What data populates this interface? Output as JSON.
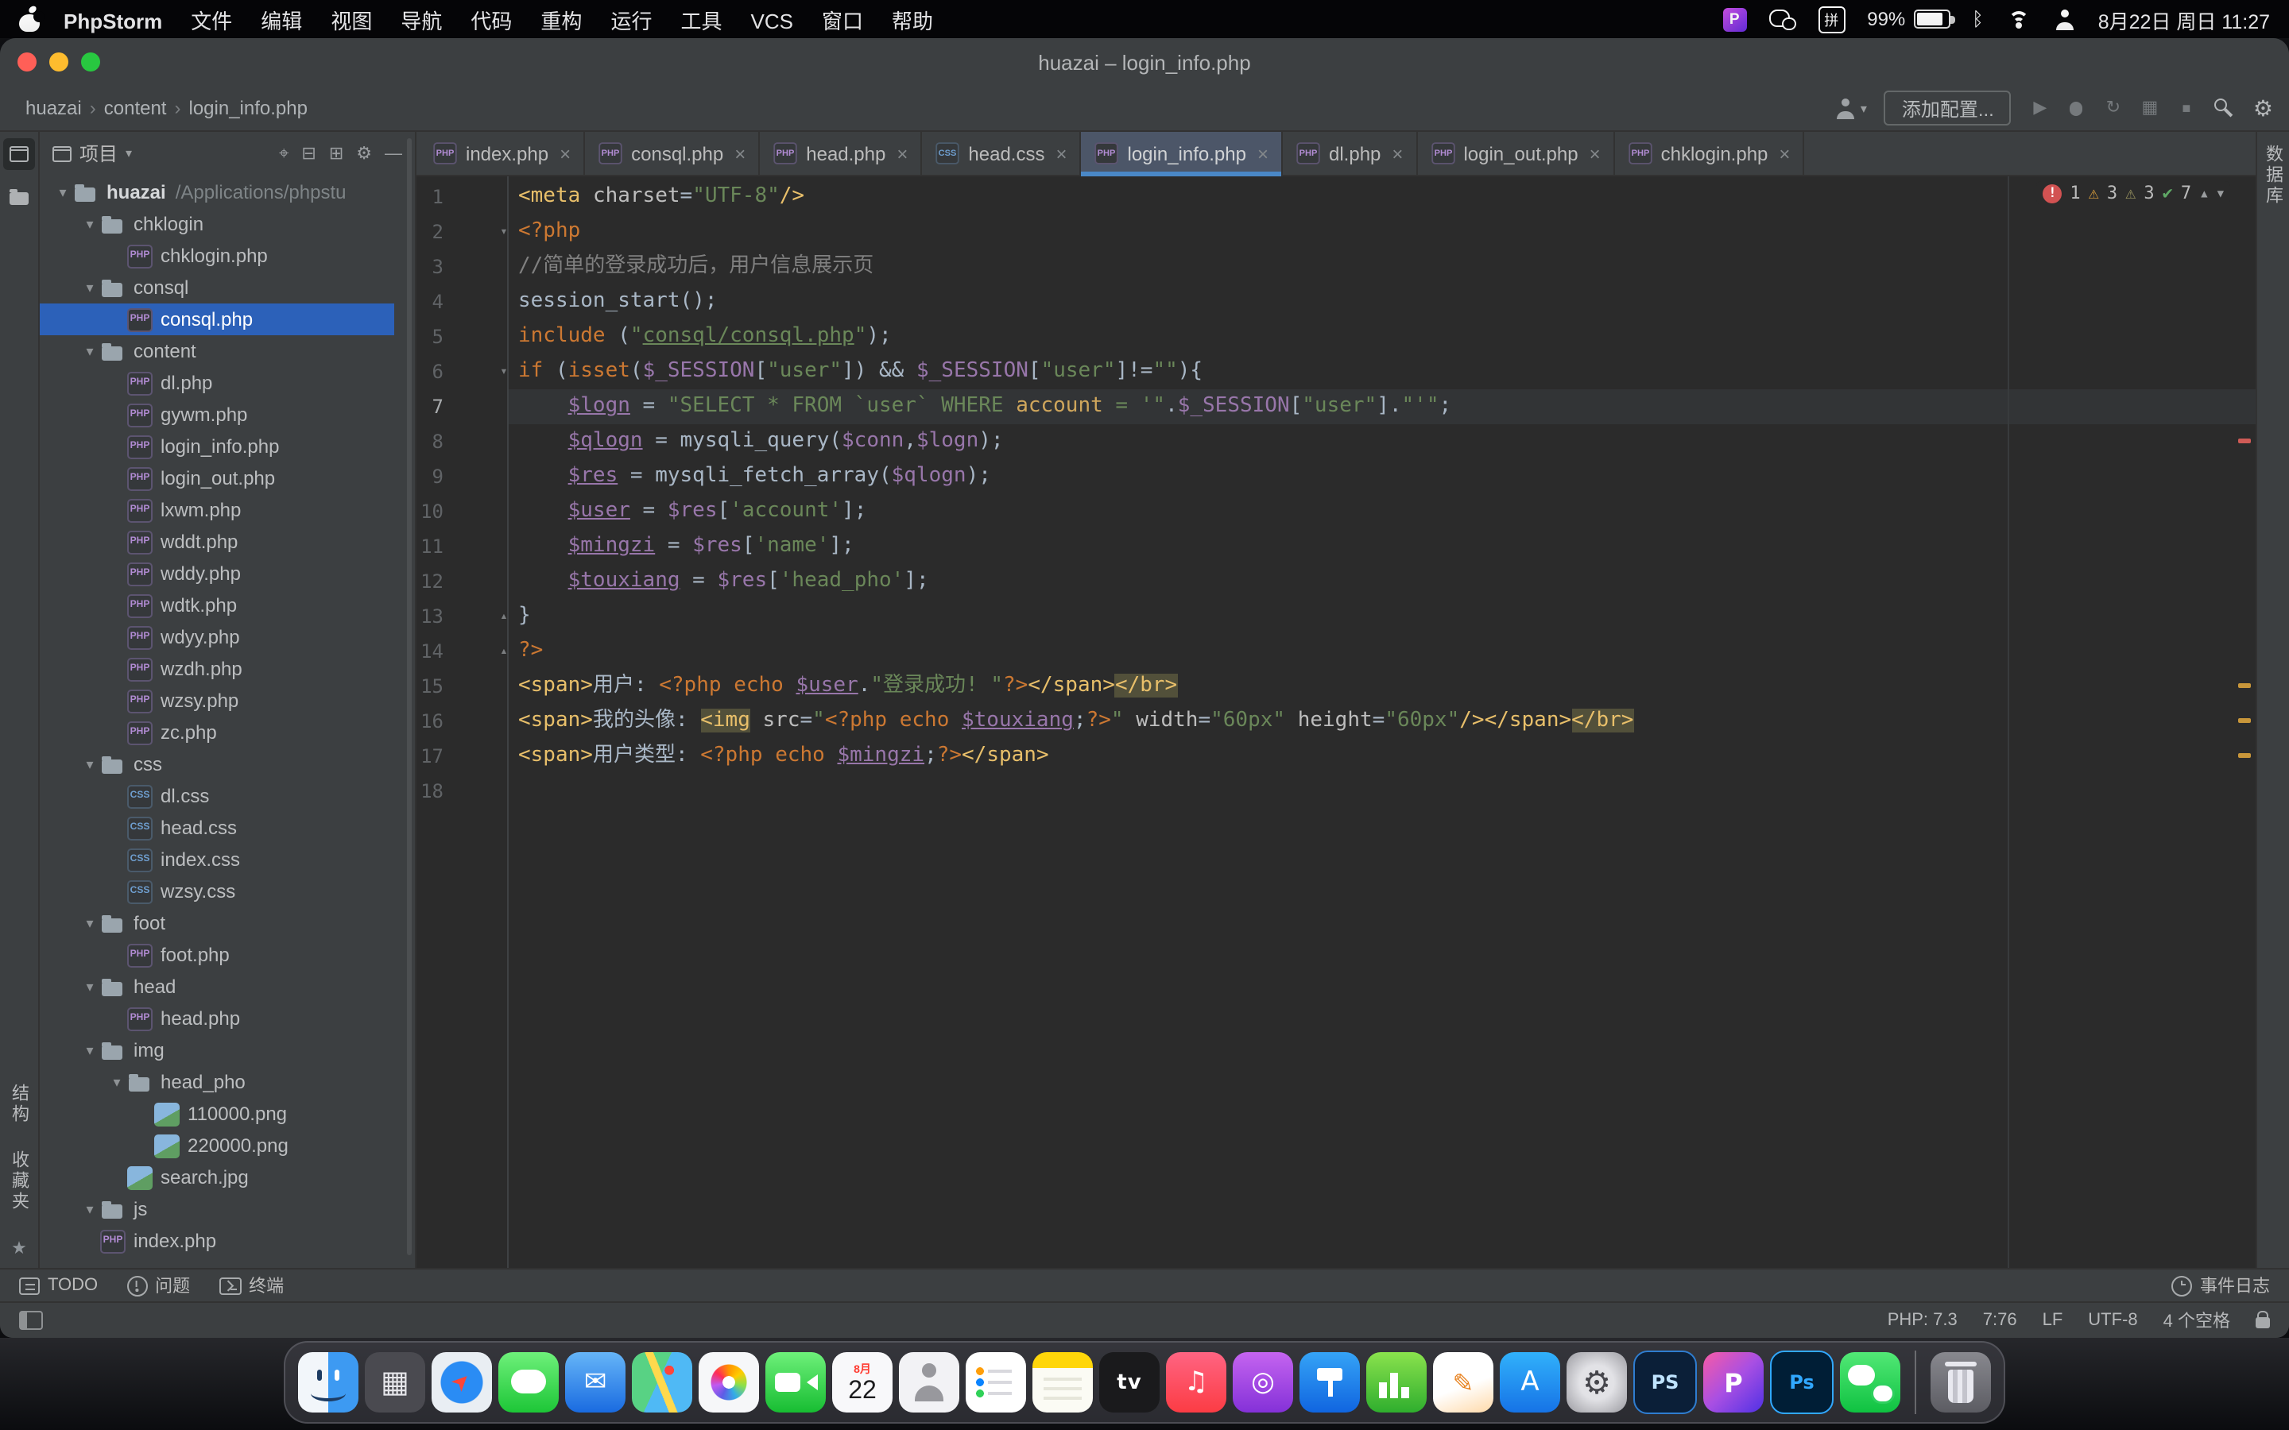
{
  "menubar": {
    "items": [
      "PhpStorm",
      "文件",
      "编辑",
      "视图",
      "导航",
      "代码",
      "重构",
      "运行",
      "工具",
      "VCS",
      "窗口",
      "帮助"
    ],
    "right": {
      "phpstorm_badge": "P",
      "ime": "拼",
      "battery_percent": "99%",
      "clock": "8月22日 周日 11:27"
    }
  },
  "window": {
    "title": "huazai – login_info.php"
  },
  "navbar": {
    "breadcrumbs": [
      "huazai",
      "content",
      "login_info.php"
    ],
    "run_config_label": "添加配置...",
    "toolbar": [
      {
        "name": "run-button",
        "glyph": "▶"
      },
      {
        "name": "debug-button",
        "glyph": ""
      },
      {
        "name": "coverage-button",
        "glyph": "↻"
      },
      {
        "name": "profiler-button",
        "glyph": "▦"
      },
      {
        "name": "stop-button",
        "glyph": "■"
      }
    ]
  },
  "tool_strips": {
    "structure": "结构",
    "favorites": "收藏夹",
    "database": "数据库"
  },
  "project_panel": {
    "title": "项目",
    "header_icons": [
      {
        "name": "locate",
        "glyph": "⌖"
      },
      {
        "name": "collapse-all",
        "glyph": "⊟"
      },
      {
        "name": "expand-all",
        "glyph": "⊞"
      },
      {
        "name": "panel-settings",
        "glyph": "⚙"
      },
      {
        "name": "hide-panel",
        "glyph": "—"
      }
    ],
    "tree": [
      {
        "n": "huazai",
        "t": "root",
        "d": 0,
        "c": true,
        "path": "/Applications/phpstu"
      },
      {
        "n": "chklogin",
        "t": "folder",
        "d": 1,
        "c": true
      },
      {
        "n": "chklogin.php",
        "t": "php",
        "d": 2
      },
      {
        "n": "consql",
        "t": "folder",
        "d": 1,
        "c": true
      },
      {
        "n": "consql.php",
        "t": "php",
        "d": 2,
        "sel": true
      },
      {
        "n": "content",
        "t": "folder",
        "d": 1,
        "c": true
      },
      {
        "n": "dl.php",
        "t": "php",
        "d": 2
      },
      {
        "n": "gywm.php",
        "t": "php",
        "d": 2
      },
      {
        "n": "login_info.php",
        "t": "php",
        "d": 2
      },
      {
        "n": "login_out.php",
        "t": "php",
        "d": 2
      },
      {
        "n": "lxwm.php",
        "t": "php",
        "d": 2
      },
      {
        "n": "wddt.php",
        "t": "php",
        "d": 2
      },
      {
        "n": "wddy.php",
        "t": "php",
        "d": 2
      },
      {
        "n": "wdtk.php",
        "t": "php",
        "d": 2
      },
      {
        "n": "wdyy.php",
        "t": "php",
        "d": 2
      },
      {
        "n": "wzdh.php",
        "t": "php",
        "d": 2
      },
      {
        "n": "wzsy.php",
        "t": "php",
        "d": 2
      },
      {
        "n": "zc.php",
        "t": "php",
        "d": 2
      },
      {
        "n": "css",
        "t": "folder",
        "d": 1,
        "c": true
      },
      {
        "n": "dl.css",
        "t": "css",
        "d": 2
      },
      {
        "n": "head.css",
        "t": "css",
        "d": 2
      },
      {
        "n": "index.css",
        "t": "css",
        "d": 2
      },
      {
        "n": "wzsy.css",
        "t": "css",
        "d": 2
      },
      {
        "n": "foot",
        "t": "folder",
        "d": 1,
        "c": true
      },
      {
        "n": "foot.php",
        "t": "php",
        "d": 2
      },
      {
        "n": "head",
        "t": "folder",
        "d": 1,
        "c": true
      },
      {
        "n": "head.php",
        "t": "php",
        "d": 2
      },
      {
        "n": "img",
        "t": "folder",
        "d": 1,
        "c": true
      },
      {
        "n": "head_pho",
        "t": "folder",
        "d": 2,
        "c": true
      },
      {
        "n": "110000.png",
        "t": "img",
        "d": 3
      },
      {
        "n": "220000.png",
        "t": "img",
        "d": 3
      },
      {
        "n": "search.jpg",
        "t": "img",
        "d": 2
      },
      {
        "n": "js",
        "t": "folder",
        "d": 1,
        "c": true
      },
      {
        "n": "index.php",
        "t": "php",
        "d": 1
      }
    ]
  },
  "editor_tabs": [
    {
      "name": "index.php",
      "type": "php"
    },
    {
      "name": "consql.php",
      "type": "php"
    },
    {
      "name": "head.php",
      "type": "php"
    },
    {
      "name": "head.css",
      "type": "css"
    },
    {
      "name": "login_info.php",
      "type": "php",
      "active": true
    },
    {
      "name": "dl.php",
      "type": "php"
    },
    {
      "name": "login_out.php",
      "type": "php"
    },
    {
      "name": "chklogin.php",
      "type": "php"
    }
  ],
  "editor": {
    "current_line": 7,
    "fold_down": [
      2,
      6
    ],
    "fold_up": [
      13,
      14
    ],
    "inspections": {
      "errors": "1",
      "warnings": "3",
      "weak_warnings": "3",
      "ok": "7"
    },
    "stripe_marks": [
      {
        "line": 8,
        "type": "error"
      },
      {
        "line": 15,
        "type": "warning"
      },
      {
        "line": 16,
        "type": "warning"
      },
      {
        "line": 17,
        "type": "warning"
      }
    ],
    "lines": [
      [
        [
          "<meta ",
          "t"
        ],
        [
          "charset",
          "a"
        ],
        [
          "=",
          "p"
        ],
        [
          "\"UTF-8\"",
          "s"
        ],
        [
          "/>",
          "t"
        ]
      ],
      [
        [
          "<?php",
          "k"
        ]
      ],
      [
        [
          "//简单的登录成功后，用户信息展示页",
          "c"
        ]
      ],
      [
        [
          "session_start();",
          "p"
        ]
      ],
      [
        [
          "include ",
          "k"
        ],
        [
          "(",
          "p"
        ],
        [
          "\"",
          "s"
        ],
        [
          "consql/consql.php",
          "su"
        ],
        [
          "\"",
          "s"
        ],
        [
          ");",
          "p"
        ]
      ],
      [
        [
          "if ",
          "k"
        ],
        [
          "(",
          "p"
        ],
        [
          "isset",
          "k"
        ],
        [
          "(",
          "p"
        ],
        [
          "$_SESSION",
          "v"
        ],
        [
          "[",
          "p"
        ],
        [
          "\"user\"",
          "s"
        ],
        [
          "]",
          "p"
        ],
        [
          ") && ",
          "p"
        ],
        [
          "$_SESSION",
          "v"
        ],
        [
          "[",
          "p"
        ],
        [
          "\"user\"",
          "s"
        ],
        [
          "]",
          "p"
        ],
        [
          "!=",
          "p"
        ],
        [
          "\"\"",
          "s"
        ],
        [
          "){",
          "p"
        ]
      ],
      [
        [
          "    ",
          "p"
        ],
        [
          "$logn",
          "vu"
        ],
        [
          " = ",
          "p"
        ],
        [
          "\"SELECT * FROM `user` WHERE ",
          "s"
        ],
        [
          "account",
          "q"
        ],
        [
          " = '\"",
          "s"
        ],
        [
          ".",
          "p"
        ],
        [
          "$_SESSION",
          "v"
        ],
        [
          "[",
          "p"
        ],
        [
          "\"user\"",
          "s"
        ],
        [
          "]",
          "p"
        ],
        [
          ".",
          "p"
        ],
        [
          "\"'\"",
          "s"
        ],
        [
          ";",
          "p"
        ]
      ],
      [
        [
          "    ",
          "p"
        ],
        [
          "$qlogn",
          "vu"
        ],
        [
          " = mysqli_query(",
          "p"
        ],
        [
          "$conn",
          "v"
        ],
        [
          ",",
          "p"
        ],
        [
          "$logn",
          "v"
        ],
        [
          ");",
          "p"
        ]
      ],
      [
        [
          "    ",
          "p"
        ],
        [
          "$res",
          "vu"
        ],
        [
          " = mysqli_fetch_array(",
          "p"
        ],
        [
          "$qlogn",
          "v"
        ],
        [
          ");",
          "p"
        ]
      ],
      [
        [
          "    ",
          "p"
        ],
        [
          "$user",
          "vu"
        ],
        [
          " = ",
          "p"
        ],
        [
          "$res",
          "v"
        ],
        [
          "[",
          "p"
        ],
        [
          "'account'",
          "s"
        ],
        [
          "];",
          "p"
        ]
      ],
      [
        [
          "    ",
          "p"
        ],
        [
          "$mingzi",
          "vu"
        ],
        [
          " = ",
          "p"
        ],
        [
          "$res",
          "v"
        ],
        [
          "[",
          "p"
        ],
        [
          "'name'",
          "s"
        ],
        [
          "];",
          "p"
        ]
      ],
      [
        [
          "    ",
          "p"
        ],
        [
          "$touxiang",
          "vu"
        ],
        [
          " = ",
          "p"
        ],
        [
          "$res",
          "v"
        ],
        [
          "[",
          "p"
        ],
        [
          "'head_pho'",
          "s"
        ],
        [
          "];",
          "p"
        ]
      ],
      [
        [
          "}",
          "p"
        ]
      ],
      [
        [
          "?>",
          "k"
        ]
      ],
      [
        [
          "<span>",
          "t"
        ],
        [
          "用户: ",
          "p"
        ],
        [
          "<?php ",
          "k"
        ],
        [
          "echo ",
          "k"
        ],
        [
          "$user",
          "vu"
        ],
        [
          ".",
          "p"
        ],
        [
          "\"登录成功! \"",
          "s"
        ],
        [
          "?>",
          "k"
        ],
        [
          "</span>",
          "t"
        ],
        [
          "</br>",
          "w"
        ]
      ],
      [
        [
          "<span>",
          "t"
        ],
        [
          "我的头像: ",
          "p"
        ],
        [
          "<img",
          "w"
        ],
        [
          " ",
          "p"
        ],
        [
          "src",
          "a"
        ],
        [
          "=",
          "p"
        ],
        [
          "\"",
          "s"
        ],
        [
          "<?php echo ",
          "k"
        ],
        [
          "$touxiang",
          "vu"
        ],
        [
          ";",
          "p"
        ],
        [
          "?>",
          "k"
        ],
        [
          "\"",
          "s"
        ],
        [
          " ",
          "p"
        ],
        [
          "width",
          "a"
        ],
        [
          "=",
          "p"
        ],
        [
          "\"60px\"",
          "s"
        ],
        [
          " ",
          "p"
        ],
        [
          "height",
          "a"
        ],
        [
          "=",
          "p"
        ],
        [
          "\"60px\"",
          "s"
        ],
        [
          "/>",
          "t"
        ],
        [
          "</span>",
          "t"
        ],
        [
          "</br>",
          "w"
        ]
      ],
      [
        [
          "<span>",
          "t"
        ],
        [
          "用户类型: ",
          "p"
        ],
        [
          "<?php ",
          "k"
        ],
        [
          "echo ",
          "k"
        ],
        [
          "$mingzi",
          "vu"
        ],
        [
          ";",
          "p"
        ],
        [
          "?>",
          "k"
        ],
        [
          "</span>",
          "t"
        ]
      ],
      []
    ]
  },
  "bottom_tool_row": {
    "left": [
      {
        "label": "TODO",
        "icon": "todo"
      },
      {
        "label": "问题",
        "icon": "problems"
      },
      {
        "label": "终端",
        "icon": "terminal"
      }
    ],
    "right": {
      "label": "事件日志"
    }
  },
  "statusbar": {
    "items": [
      "PHP: 7.3",
      "7:76",
      "LF",
      "UTF-8",
      "4 个空格"
    ]
  },
  "icons": {
    "tree_expanded": "▾",
    "fold_down": "▾",
    "fold_up": "▴",
    "close": "×",
    "breadcrumb_sep": "›",
    "caret_down": "▾",
    "error": "!",
    "warning": "⚠",
    "weak_warning": "⚠",
    "ok": "✔",
    "prev": "▲",
    "next": "▼",
    "gear": "⚙",
    "bluetooth": "ᛒ",
    "star": "★"
  },
  "dock": {
    "items": [
      {
        "id": "finder"
      },
      {
        "id": "launchpad",
        "glyph": "▦"
      },
      {
        "id": "safari",
        "glyph": "➤"
      },
      {
        "id": "messages"
      },
      {
        "id": "mail",
        "glyph": "✉"
      },
      {
        "id": "maps"
      },
      {
        "id": "photos"
      },
      {
        "id": "facetime"
      },
      {
        "id": "calendar",
        "cal_month": "8月",
        "cal_day": "22"
      },
      {
        "id": "contacts"
      },
      {
        "id": "reminders"
      },
      {
        "id": "notes"
      },
      {
        "id": "tv",
        "glyph": "tv"
      },
      {
        "id": "music",
        "glyph": "♫"
      },
      {
        "id": "podcasts",
        "glyph": "◎"
      },
      {
        "id": "keynote"
      },
      {
        "id": "numbers"
      },
      {
        "id": "pages",
        "glyph": "✎"
      },
      {
        "id": "appstore",
        "glyph": "A"
      },
      {
        "id": "syspref",
        "glyph": "⚙"
      },
      {
        "id": "ps-dark",
        "glyph": "PS"
      },
      {
        "id": "phpstorm",
        "glyph": "P"
      },
      {
        "id": "ps-blue",
        "glyph": "Ps"
      },
      {
        "id": "wechat"
      },
      {
        "id": "divider"
      },
      {
        "id": "trash"
      }
    ]
  }
}
